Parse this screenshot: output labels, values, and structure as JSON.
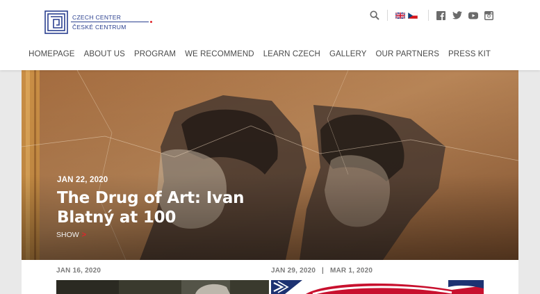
{
  "header": {
    "logo_line1": "CZECH CENTER",
    "logo_line2": "ČESKÉ CENTRUM",
    "brand_color": "#2a3f8f",
    "accent_color": "#e0262b",
    "tools": [
      "search-icon",
      "uk-flag",
      "czech-flag",
      "facebook-icon",
      "twitter-icon",
      "youtube-icon",
      "instagram-icon"
    ]
  },
  "nav": {
    "items": [
      "HOMEPAGE",
      "ABOUT US",
      "PROGRAM",
      "WE RECOMMEND",
      "LEARN CZECH",
      "GALLERY",
      "OUR PARTNERS",
      "PRESS KIT"
    ]
  },
  "hero": {
    "date": "JAN 22, 2020",
    "title": "The Drug of Art: Ivan Blatný at 100",
    "show_label": "SHOW",
    "show_chevron": ">"
  },
  "listing": {
    "cards": [
      {
        "date": "JAN 16, 2020"
      },
      {
        "date": "JAN 29, 2020   |   MAR 1, 2020"
      }
    ]
  }
}
